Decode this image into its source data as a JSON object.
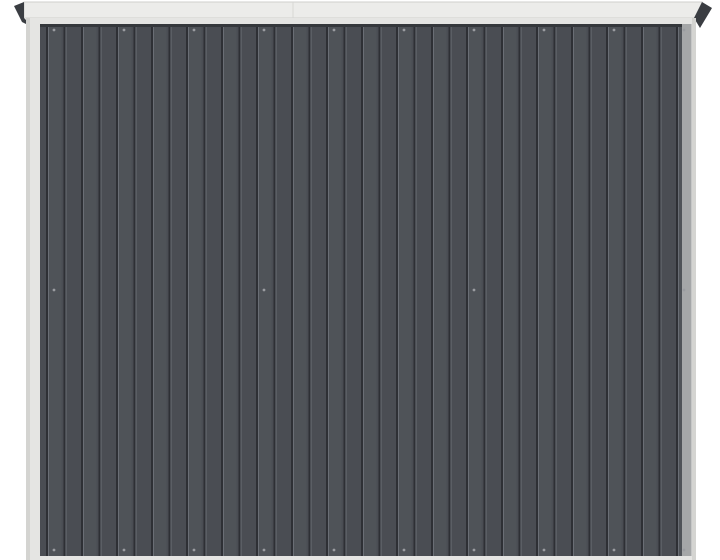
{
  "image": {
    "subject": "shed-wall",
    "colors": {
      "background": "#ffffff",
      "frame": "#e5e5e3",
      "frame_shadow": "#c9c9c6",
      "roof_trim": "#ececea",
      "roof_shadow": "#3a3d42",
      "panel_base": "#4a4d53",
      "panel_light": "#565a60",
      "rib_dark": "#2e3035",
      "rib_highlight": "#6a6e75",
      "rivet": "#9a9ca0"
    }
  }
}
